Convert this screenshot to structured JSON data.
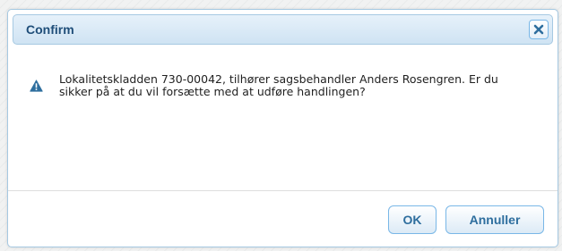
{
  "dialog": {
    "title": "Confirm",
    "message": "Lokalitetskladden 730-00042, tilhører sagsbehandler Anders Rosengren. Er du sikker på at du vil forsætte med at udføre handlingen?",
    "icon": "warning-icon",
    "close_icon": "close-icon"
  },
  "buttons": {
    "ok_label": "OK",
    "cancel_label": "Annuller"
  },
  "colors": {
    "title_text": "#1f4e79",
    "border": "#a6c9e2",
    "button_text": "#2e6e9e",
    "warning_icon": "#2e6e9e"
  }
}
